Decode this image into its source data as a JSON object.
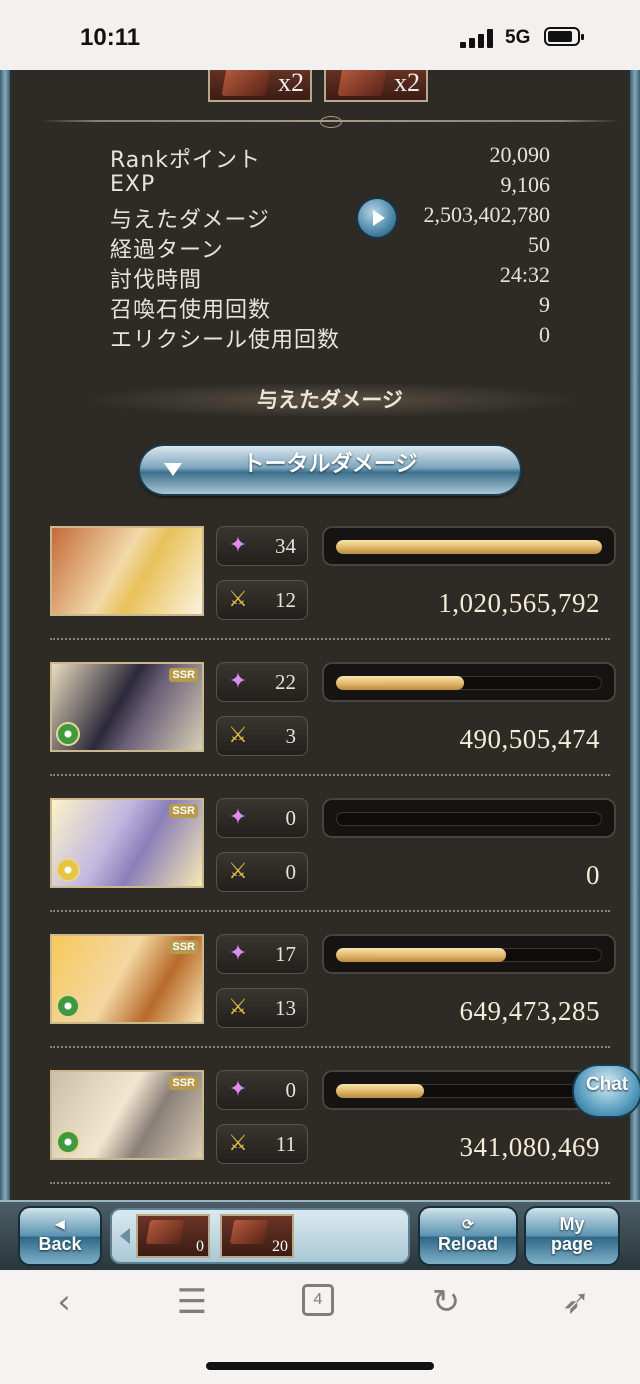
{
  "status_bar": {
    "time": "10:11",
    "network": "5G"
  },
  "rewards": [
    {
      "qty": "x2"
    },
    {
      "qty": "x2"
    }
  ],
  "stats": [
    {
      "label": "Rankポイント",
      "value": "20,090"
    },
    {
      "label": "EXP",
      "value": "9,106"
    },
    {
      "label": "与えたダメージ",
      "value": "2,503,402,780"
    },
    {
      "label": "経過ターン",
      "value": "50"
    },
    {
      "label": "討伐時間",
      "value": "24:32"
    },
    {
      "label": "召喚石使用回数",
      "value": "9"
    },
    {
      "label": "エリクシール使用回数",
      "value": "0"
    }
  ],
  "section_title": "与えたダメージ",
  "dropdown_label": "トータルダメージ",
  "characters": [
    {
      "badge": "",
      "element": "",
      "skills": "34",
      "attacks": "12",
      "damage": "1,020,565,792",
      "bar_fraction": 1.0
    },
    {
      "badge": "SSR",
      "element": "wind",
      "skills": "22",
      "attacks": "3",
      "damage": "490,505,474",
      "bar_fraction": 0.48
    },
    {
      "badge": "SSR",
      "element": "light",
      "skills": "0",
      "attacks": "0",
      "damage": "0",
      "bar_fraction": 0
    },
    {
      "badge": "SSR",
      "element": "wind",
      "skills": "17",
      "attacks": "13",
      "damage": "649,473,285",
      "bar_fraction": 0.64
    },
    {
      "badge": "SSR",
      "element": "wind",
      "skills": "0",
      "attacks": "11",
      "damage": "341,080,469",
      "bar_fraction": 0.33
    }
  ],
  "chat_label": "Chat",
  "bottom_bar": {
    "back_label": "Back",
    "reload_label": "Reload",
    "mypage_line1": "My",
    "mypage_line2": "page",
    "items": [
      {
        "count": "0"
      },
      {
        "count": "20"
      }
    ]
  },
  "browser": {
    "tab_count": "4"
  },
  "colors": {
    "bar_fill": "#e0b66a",
    "panel": "#2e2b27",
    "button_blue": "#5b92b0"
  }
}
